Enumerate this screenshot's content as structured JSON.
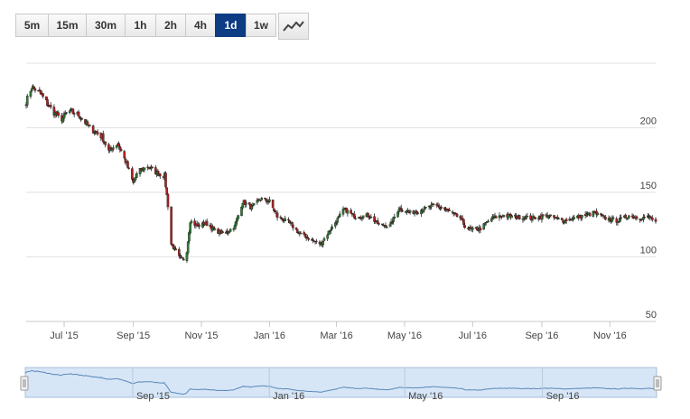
{
  "toolbar": {
    "timeframes": [
      "5m",
      "15m",
      "30m",
      "1h",
      "2h",
      "4h",
      "1d",
      "1w"
    ],
    "active": "1d",
    "chart_type_icon": "line-chart-icon"
  },
  "chart_data": {
    "type": "candlestick",
    "x_range": [
      "2015-05-28",
      "2016-12-12"
    ],
    "y_range": [
      50,
      250
    ],
    "y_ticks": [
      50,
      100,
      150,
      200
    ],
    "y_tick_labels": [
      "50",
      "100",
      "150",
      "200"
    ],
    "x_ticks": [
      "2015-07-01",
      "2015-09-01",
      "2015-11-01",
      "2016-01-01",
      "2016-03-01",
      "2016-05-01",
      "2016-07-01",
      "2016-09-01",
      "2016-11-01"
    ],
    "x_tick_labels": [
      "Jul '15",
      "Sep '15",
      "Nov '15",
      "Jan '16",
      "Mar '16",
      "May '16",
      "Jul '16",
      "Sep '16",
      "Nov '16"
    ],
    "grid": true,
    "y_axis_side": "right",
    "anchors": [
      [
        "2015-05-28",
        220
      ],
      [
        "2015-06-02",
        232
      ],
      [
        "2015-06-10",
        226
      ],
      [
        "2015-06-18",
        216
      ],
      [
        "2015-06-28",
        206
      ],
      [
        "2015-07-05",
        213
      ],
      [
        "2015-07-14",
        210
      ],
      [
        "2015-07-24",
        200
      ],
      [
        "2015-08-04",
        193
      ],
      [
        "2015-08-10",
        182
      ],
      [
        "2015-08-18",
        188
      ],
      [
        "2015-08-26",
        172
      ],
      [
        "2015-09-01",
        157
      ],
      [
        "2015-09-05",
        166
      ],
      [
        "2015-09-14",
        170
      ],
      [
        "2015-09-22",
        165
      ],
      [
        "2015-09-29",
        163
      ],
      [
        "2015-10-02",
        140
      ],
      [
        "2015-10-05",
        110
      ],
      [
        "2015-10-12",
        100
      ],
      [
        "2015-10-18",
        97
      ],
      [
        "2015-10-22",
        128
      ],
      [
        "2015-10-28",
        124
      ],
      [
        "2015-11-05",
        126
      ],
      [
        "2015-11-14",
        120
      ],
      [
        "2015-11-22",
        118
      ],
      [
        "2015-12-01",
        124
      ],
      [
        "2015-12-08",
        143
      ],
      [
        "2015-12-16",
        138
      ],
      [
        "2015-12-24",
        145
      ],
      [
        "2016-01-01",
        143
      ],
      [
        "2016-01-08",
        131
      ],
      [
        "2016-01-18",
        127
      ],
      [
        "2016-01-28",
        118
      ],
      [
        "2016-02-08",
        113
      ],
      [
        "2016-02-16",
        110
      ],
      [
        "2016-02-22",
        118
      ],
      [
        "2016-03-01",
        128
      ],
      [
        "2016-03-08",
        137
      ],
      [
        "2016-03-18",
        131
      ],
      [
        "2016-03-30",
        132
      ],
      [
        "2016-04-08",
        125
      ],
      [
        "2016-04-18",
        124
      ],
      [
        "2016-04-26",
        138
      ],
      [
        "2016-05-06",
        134
      ],
      [
        "2016-05-18",
        137
      ],
      [
        "2016-05-28",
        140
      ],
      [
        "2016-06-08",
        136
      ],
      [
        "2016-06-14",
        133
      ],
      [
        "2016-06-20",
        130
      ],
      [
        "2016-06-24",
        124
      ],
      [
        "2016-06-30",
        121
      ],
      [
        "2016-07-08",
        122
      ],
      [
        "2016-07-18",
        130
      ],
      [
        "2016-07-28",
        132
      ],
      [
        "2016-08-10",
        131
      ],
      [
        "2016-08-24",
        130
      ],
      [
        "2016-09-06",
        132
      ],
      [
        "2016-09-20",
        128
      ],
      [
        "2016-10-04",
        131
      ],
      [
        "2016-10-18",
        134
      ],
      [
        "2016-10-28",
        130
      ],
      [
        "2016-11-08",
        128
      ],
      [
        "2016-11-18",
        132
      ],
      [
        "2016-11-28",
        130
      ],
      [
        "2016-12-06",
        131
      ],
      [
        "2016-12-12",
        127
      ]
    ]
  },
  "navigator": {
    "x_tick_labels": [
      "Sep '15",
      "Jan '16",
      "May '16",
      "Sep '16"
    ],
    "x_ticks": [
      "2015-09-01",
      "2016-01-01",
      "2016-05-01",
      "2016-09-01"
    ]
  },
  "colors": {
    "up": "#2e7d32",
    "down": "#b71c1c",
    "navigator_fill": "#d6e6f7",
    "navigator_line": "#5b87b7",
    "active_button": "#0d3b84"
  }
}
